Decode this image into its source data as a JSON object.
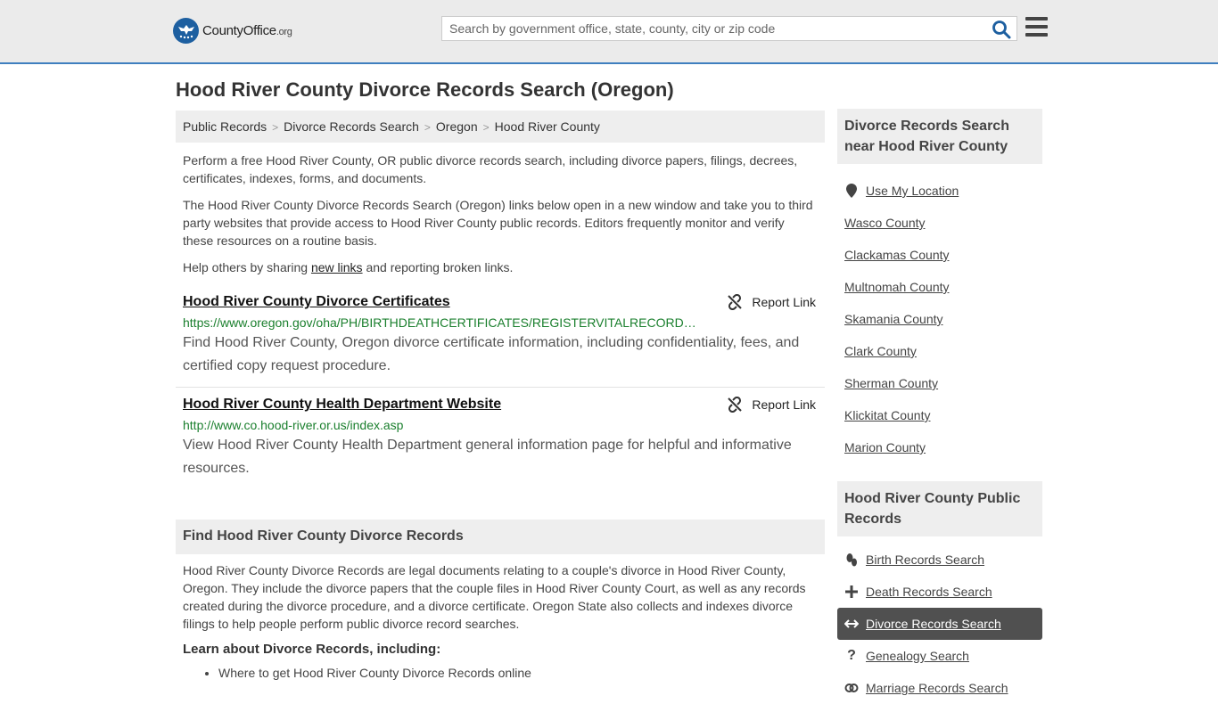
{
  "header": {
    "logo_text_main": "CountyOffice",
    "logo_text_suffix": ".org",
    "search_placeholder": "Search by government office, state, county, city or zip code"
  },
  "page_title": "Hood River County Divorce Records Search (Oregon)",
  "breadcrumb": [
    "Public Records",
    "Divorce Records Search",
    "Oregon",
    "Hood River County"
  ],
  "intro": {
    "p1": "Perform a free Hood River County, OR public divorce records search, including divorce papers, filings, decrees, certificates, indexes, forms, and documents.",
    "p2": "The Hood River County Divorce Records Search (Oregon) links below open in a new window and take you to third party websites that provide access to Hood River County public records. Editors frequently monitor and verify these resources on a routine basis.",
    "p3_before": "Help others by sharing ",
    "p3_link": "new links",
    "p3_after": " and reporting broken links."
  },
  "links": [
    {
      "title": "Hood River County Divorce Certificates",
      "url": "https://www.oregon.gov/oha/PH/BIRTHDEATHCERTIFICATES/REGISTERVITALRECORD…",
      "desc": "Find Hood River County, Oregon divorce certificate information, including confidentiality, fees, and certified copy request procedure.",
      "report": "Report Link"
    },
    {
      "title": "Hood River County Health Department Website",
      "url": "http://www.co.hood-river.or.us/index.asp",
      "desc": "View Hood River County Health Department general information page for helpful and informative resources.",
      "report": "Report Link"
    }
  ],
  "find_section": {
    "heading": "Find Hood River County Divorce Records",
    "body": "Hood River County Divorce Records are legal documents relating to a couple's divorce in Hood River County, Oregon. They include the divorce papers that the couple files in Hood River County Court, as well as any records created during the divorce procedure, and a divorce certificate. Oregon State also collects and indexes divorce filings to help people perform public divorce record searches.",
    "learn": "Learn about Divorce Records, including:",
    "bullets": [
      "Where to get Hood River County Divorce Records online"
    ]
  },
  "sidebar": {
    "nearby_heading": "Divorce Records Search near Hood River County",
    "use_location": "Use My Location",
    "nearby": [
      "Wasco County",
      "Clackamas County",
      "Multnomah County",
      "Skamania County",
      "Clark County",
      "Sherman County",
      "Klickitat County",
      "Marion County"
    ],
    "public_heading": "Hood River County Public Records",
    "public_links": [
      {
        "label": "Birth Records Search",
        "icon": "footprint-icon"
      },
      {
        "label": "Death Records Search",
        "icon": "cross-icon"
      },
      {
        "label": "Divorce Records Search",
        "icon": "arrows-split-icon",
        "active": true
      },
      {
        "label": "Genealogy Search",
        "icon": "question-icon"
      },
      {
        "label": "Marriage Records Search",
        "icon": "rings-icon"
      }
    ]
  },
  "colors": {
    "header_bg": "#ebebeb",
    "header_border": "#3f7fbf",
    "url_green": "#1a7f2d",
    "active_bg": "#505050",
    "search_icon": "#1d5fa0"
  }
}
